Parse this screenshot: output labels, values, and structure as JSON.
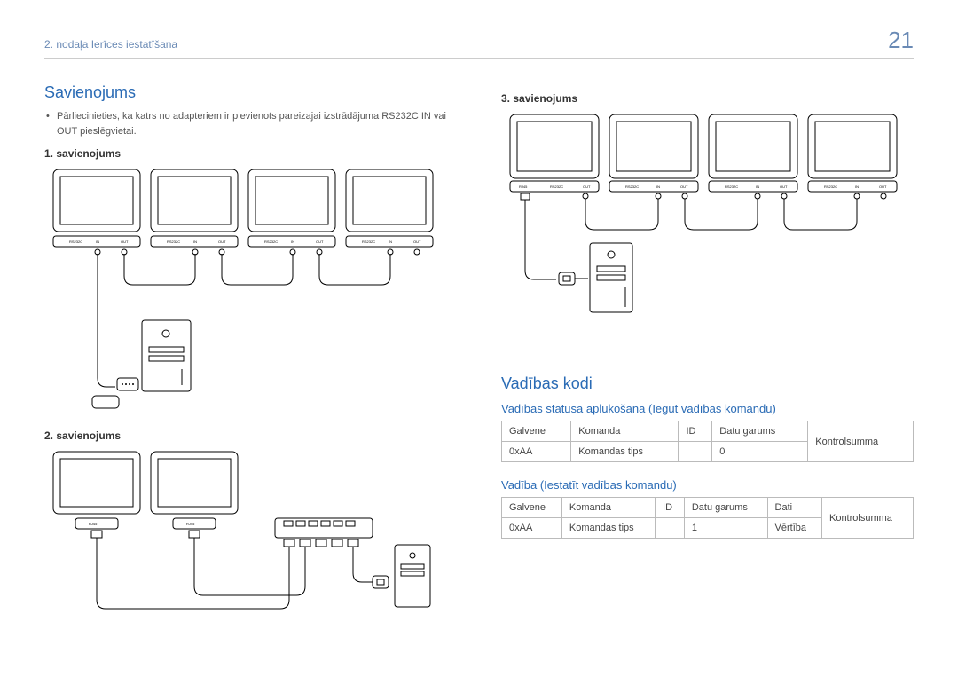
{
  "header": {
    "chapter": "2. nodaļa Ierīces iestatīšana",
    "page": "21"
  },
  "left": {
    "h2": "Savienojums",
    "bullet": "Pārliecinieties, ka katrs no adapteriem ir pievienots pareizajai izstrādājuma RS232C IN vai OUT pieslēgvietai.",
    "sub1": "1. savienojums",
    "sub2": "2. savienojums"
  },
  "right": {
    "sub3": "3. savienojums",
    "h2b": "Vadības kodi",
    "h3a": "Vadības statusa aplūkošana (Iegūt vadības komandu)",
    "h3b": "Vadība (Iestatīt vadības komandu)",
    "table1": {
      "r1": {
        "c1": "Galvene",
        "c2": "Komanda",
        "c3": "ID",
        "c4": "Datu garums",
        "c5": "Kontrolsumma"
      },
      "r2": {
        "c1": "0xAA",
        "c2": "Komandas tips",
        "c3": "",
        "c4": "0",
        "c5": ""
      }
    },
    "table2": {
      "r1": {
        "c1": "Galvene",
        "c2": "Komanda",
        "c3": "ID",
        "c4": "Datu garums",
        "c5": "Dati",
        "c6": "Kontrolsumma"
      },
      "r2": {
        "c1": "0xAA",
        "c2": "Komandas tips",
        "c3": "",
        "c4": "1",
        "c5": "Vērtība",
        "c6": ""
      }
    }
  },
  "labels": {
    "rs232c": "RS232C",
    "rj45": "RJ45",
    "in": "IN",
    "out": "OUT"
  }
}
